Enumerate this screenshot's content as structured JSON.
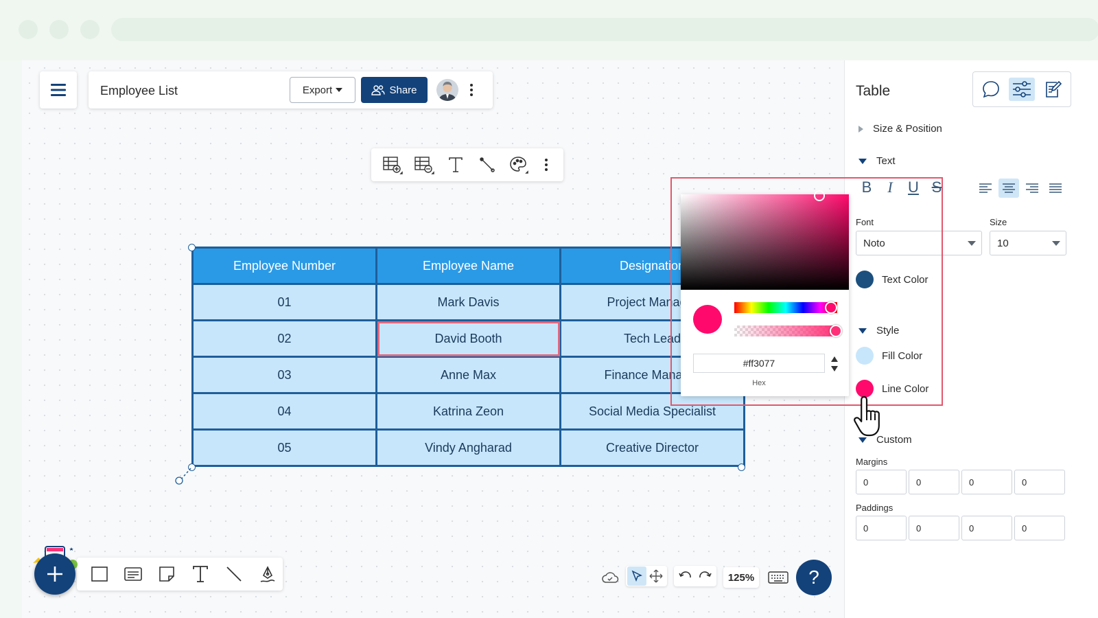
{
  "document": {
    "title": "Employee List"
  },
  "header": {
    "export_label": "Export",
    "share_label": "Share"
  },
  "table": {
    "headers": [
      "Employee Number",
      "Employee Name",
      "Designation"
    ],
    "rows": [
      [
        "01",
        "Mark Davis",
        "Project Manager"
      ],
      [
        "02",
        "David Booth",
        "Tech Lead"
      ],
      [
        "03",
        "Anne Max",
        "Finance Manager"
      ],
      [
        "04",
        "Katrina Zeon",
        "Social Media Specialist"
      ],
      [
        "05",
        "Vindy Angharad",
        "Creative Director"
      ]
    ]
  },
  "toolbar": {
    "zoom": "125%",
    "help": "?"
  },
  "panel": {
    "title": "Table",
    "sections": {
      "size_position": "Size & Position",
      "text": "Text",
      "style": "Style",
      "custom": "Custom"
    },
    "format_buttons": [
      "B",
      "I",
      "U",
      "S"
    ],
    "font_label": "Font",
    "font_value": "Noto",
    "size_label": "Size",
    "size_value": "10",
    "text_color_label": "Text Color",
    "fill_color_label": "Fill Color",
    "line_color_label": "Line Color",
    "margins_label": "Margins",
    "margins": [
      "0",
      "0",
      "0",
      "0"
    ],
    "paddings_label": "Paddings",
    "paddings": [
      "0",
      "0",
      "0",
      "0"
    ]
  },
  "color_picker": {
    "hex_value": "#ff3077",
    "hex_label": "Hex"
  },
  "colors": {
    "brand": "#13427a",
    "header_fill": "#2b9ae6",
    "cell_fill": "#c7e6fb",
    "text_color": "#1b4f7e",
    "fill_color": "#c7e6fb",
    "line_color": "#ff0a6c",
    "highlight": "#e2576c"
  }
}
